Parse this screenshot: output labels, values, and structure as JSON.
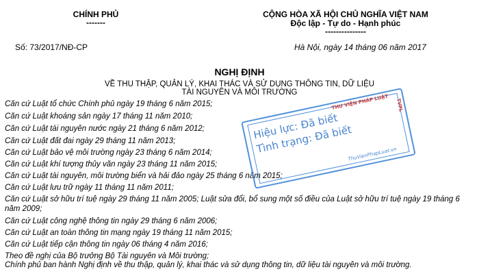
{
  "header": {
    "left_title": "CHÍNH PHỦ",
    "left_rule": "-------",
    "right_title": "CỘNG HÒA XÃ HỘI CHỦ NGHĨA VIỆT NAM",
    "right_motto": "Độc lập - Tự do - Hạnh phúc",
    "right_rule": "---------------",
    "doc_number": "Số: 73/2017/NĐ-CP",
    "date_line": "Hà Nội, ngày 14 tháng 06 năm 2017"
  },
  "doc_type": "NGHỊ ĐỊNH",
  "subject": "VỀ THU THẬP, QUẢN LÝ, KHAI THÁC VÀ SỬ DỤNG THÔNG TIN, DỮ LIỆU TÀI NGUYÊN VÀ MÔI TRƯỜNG",
  "basis_lines": [
    "Căn cứ Luật tổ chức Chính phủ ngày 19 tháng 6 năm 2015;",
    "Căn cứ Luật khoáng sản ngày 17 tháng 11 năm 2010;",
    "Căn cứ Luật tài nguyên nước ngày 21 tháng 6 năm 2012;",
    "Căn cứ Luật đất đai ngày 29 tháng 11 năm 2013;",
    "Căn cứ Luật bảo vệ môi trường ngày 23 tháng 6 năm 2014;",
    "Căn cứ Luật khí tượng thủy văn ngày 23 tháng 11 năm 2015;",
    "Căn cứ Luật tài nguyên, môi trường biển và hải đảo ngày 25 tháng 6 năm 2015;",
    "Căn cứ Luật lưu trữ ngày 11 tháng 11 năm 2011;",
    "Căn cứ Luật sở hữu trí tuệ ngày 29 tháng 11 năm 2005; Luật sửa đổi, bổ sung một số điều của Luật sở hữu trí tuệ ngày 19 tháng 6 năm 2009;",
    "Căn cứ Luật công nghệ thông tin ngày 29 tháng 6 năm 2006;",
    "Căn cứ Luật an toàn thông tin mạng ngày 19 tháng 11 năm 2015;",
    "Căn cứ Luật tiếp cận thông tin ngày 06 tháng 4 năm 2016;",
    "Theo đề nghị của Bộ trưởng Bộ Tài nguyên và Môi trường;",
    "Chính phủ ban hành Nghị định về thu thập, quản lý, khai thác và sử dụng thông tin, dữ liệu tài nguyên và môi trường."
  ],
  "stamp": {
    "line1": "Hiệu lực: Đã biết",
    "line2": "Tình trạng: Đã biết",
    "brand": "THƯ VIỆN PHÁP LUẬT",
    "site": "ThuVienPhapLuat.vn",
    "side_text": "TVPL",
    "color": "#2f74c9"
  }
}
